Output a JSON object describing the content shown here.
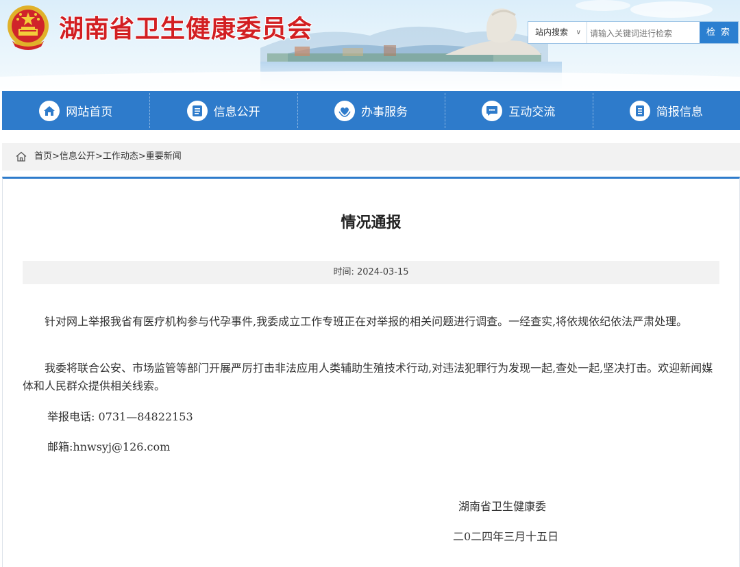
{
  "header": {
    "site_title": "湖南省卫生健康委员会",
    "search": {
      "scope_label": "站内搜索",
      "placeholder": "请输入关键词进行检索",
      "button_label": "检 索"
    }
  },
  "nav": {
    "items": [
      {
        "label": "网站首页",
        "icon": "home-icon"
      },
      {
        "label": "信息公开",
        "icon": "document-list-icon"
      },
      {
        "label": "办事服务",
        "icon": "heart-hands-icon"
      },
      {
        "label": "互动交流",
        "icon": "chat-bubble-icon"
      },
      {
        "label": "简报信息",
        "icon": "notepad-icon"
      }
    ]
  },
  "breadcrumb": {
    "items": [
      "首页",
      "信息公开",
      "工作动态",
      "重要新闻"
    ],
    "separator": ">"
  },
  "article": {
    "title": "情况通报",
    "time_label": "时间:",
    "date": "2024-03-15",
    "paragraphs": [
      "针对网上举报我省有医疗机构参与代孕事件,我委成立工作专班正在对举报的相关问题进行调查。一经查实,将依规依纪依法严肃处理。",
      "我委将联合公安、市场监管等部门开展严厉打击非法应用人类辅助生殖技术行动,对违法犯罪行为发现一起,查处一起,坚决打击。欢迎新闻媒体和人民群众提供相关线索。"
    ],
    "hotline": "举报电话: 0731—84822153",
    "email": "邮箱:hnwsyj@126.com",
    "signature_org": "湖南省卫生健康委",
    "signature_date": "二0二四年三月十五日"
  },
  "colors": {
    "brand_red": "#d21f22",
    "nav_blue": "#2e7bcb",
    "search_button": "#2b7fd0"
  }
}
